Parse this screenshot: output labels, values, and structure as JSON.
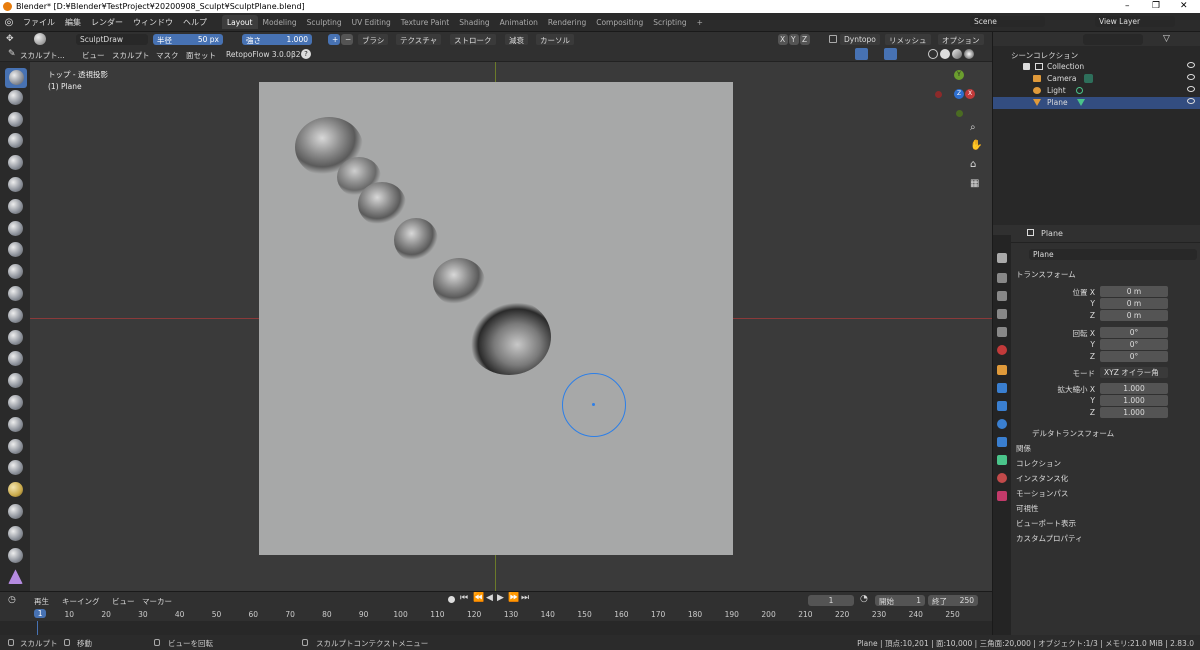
{
  "window": {
    "title": "Blender* [D:¥Blender¥TestProject¥20200908_Sculpt¥SculptPlane.blend]",
    "controls": [
      "–",
      "❐",
      "✕"
    ]
  },
  "menu": [
    "ファイル",
    "編集",
    "レンダー",
    "ウィンドウ",
    "ヘルプ"
  ],
  "workspaces": [
    "Layout",
    "Modeling",
    "Sculpting",
    "UV Editing",
    "Texture Paint",
    "Shading",
    "Animation",
    "Rendering",
    "Compositing",
    "Scripting"
  ],
  "workspace_add": "+",
  "scene": {
    "name": "Scene",
    "view_layer": "View Layer"
  },
  "tool_header": {
    "brush_name": "SculptDraw",
    "radius_label": "半径",
    "radius_value": "50 px",
    "strength_label": "強さ",
    "strength_value": "1.000",
    "plus": "+",
    "minus": "−",
    "menus": [
      "ブラシ",
      "テクスチャ",
      "ストローク",
      "減衰",
      "カーソル"
    ],
    "xyz": [
      "X",
      "Y",
      "Z"
    ],
    "dyntopo": "Dyntopo",
    "remesh": "リメッシュ",
    "options": "オプション"
  },
  "editor_header": {
    "mode": "スカルプト...",
    "menus": [
      "ビュー",
      "スカルプト",
      "マスク",
      "面セット"
    ],
    "addon": "RetopoFlow 3.0.0β2",
    "help": "?"
  },
  "viewport": {
    "view_name": "トップ - 透視投影",
    "object_name": "(1) Plane",
    "gizmo": {
      "y": "Y",
      "z": "Z",
      "x": "X"
    }
  },
  "outliner": {
    "root": "シーンコレクション",
    "items": [
      {
        "name": "Collection",
        "selected": false
      },
      {
        "name": "Camera",
        "selected": false
      },
      {
        "name": "Light",
        "selected": false
      },
      {
        "name": "Plane",
        "selected": true
      }
    ]
  },
  "properties": {
    "object": "Plane",
    "data_name": "Plane",
    "section_transform": "トランスフォーム",
    "location_label": "位置 X",
    "location": [
      "0 m",
      "0 m",
      "0 m"
    ],
    "rotation_label": "回転 X",
    "rotation": [
      "0°",
      "0°",
      "0°"
    ],
    "mode_label": "モード",
    "mode_value": "XYZ オイラー角",
    "scale_label": "拡大縮小 X",
    "scale": [
      "1.000",
      "1.000",
      "1.000"
    ],
    "axis_y": "Y",
    "axis_z": "Z",
    "delta": "デルタトランスフォーム",
    "sections": [
      "関係",
      "コレクション",
      "インスタンス化",
      "モーションパス",
      "可視性",
      "ビューポート表示",
      "カスタムプロパティ"
    ]
  },
  "timeline": {
    "menus": [
      "再生",
      "キーイング",
      "ビュー",
      "マーカー"
    ],
    "current_frame": "1",
    "start_label": "開始",
    "start": "1",
    "end_label": "終了",
    "end": "250",
    "ticks": [
      "1",
      "10",
      "20",
      "30",
      "40",
      "50",
      "60",
      "70",
      "80",
      "90",
      "100",
      "110",
      "120",
      "130",
      "140",
      "150",
      "160",
      "170",
      "180",
      "190",
      "200",
      "210",
      "220",
      "230",
      "240",
      "250"
    ]
  },
  "status": {
    "left": [
      "スカルプト",
      "移動",
      "ビューを回転",
      "スカルプトコンテクストメニュー"
    ],
    "right": "Plane | 頂点:10,201 | 面:10,000 | 三角面:20,000 | オブジェクト:1/3 | メモリ:21.0 MiB | 2.83.0"
  }
}
